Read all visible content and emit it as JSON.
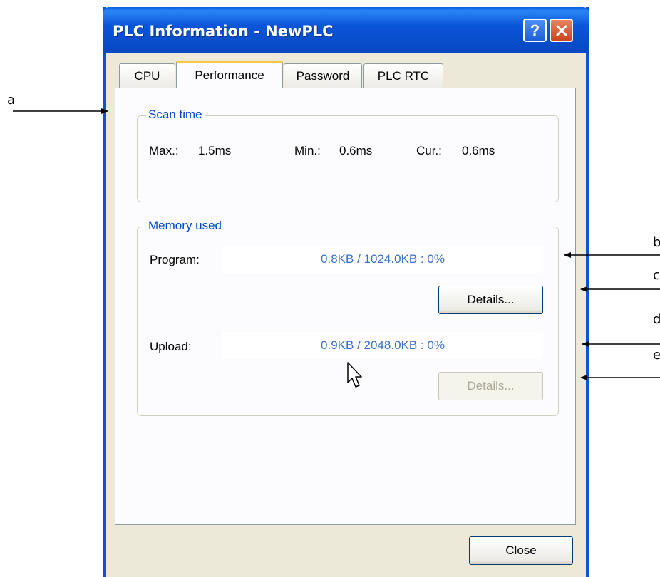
{
  "dialog": {
    "title": "PLC Information - NewPLC",
    "help_glyph": "?",
    "close_glyph": "✕",
    "close_button_label": "Close"
  },
  "tabs": [
    {
      "label": "CPU",
      "active": false
    },
    {
      "label": "Performance",
      "active": true
    },
    {
      "label": "Password",
      "active": false
    },
    {
      "label": "PLC RTC",
      "active": false
    }
  ],
  "scan_time": {
    "legend": "Scan time",
    "max_label": "Max.:",
    "max_value": "1.5ms",
    "min_label": "Min.:",
    "min_value": "0.6ms",
    "cur_label": "Cur.:",
    "cur_value": "0.6ms"
  },
  "memory": {
    "legend": "Memory used",
    "program_label": "Program:",
    "program_value": "0.8KB / 1024.0KB : 0%",
    "program_details": "Details...",
    "upload_label": "Upload:",
    "upload_value": "0.9KB / 2048.0KB : 0%",
    "upload_details": "Details..."
  },
  "annotations": {
    "a": "a",
    "b": "b",
    "c": "c",
    "d": "d",
    "e": "e"
  },
  "colors": {
    "title_bar": "#0a56d9",
    "legend_text": "#0046d5",
    "value_text": "#3a6fc9",
    "active_tab_accent": "#ffc83c"
  }
}
